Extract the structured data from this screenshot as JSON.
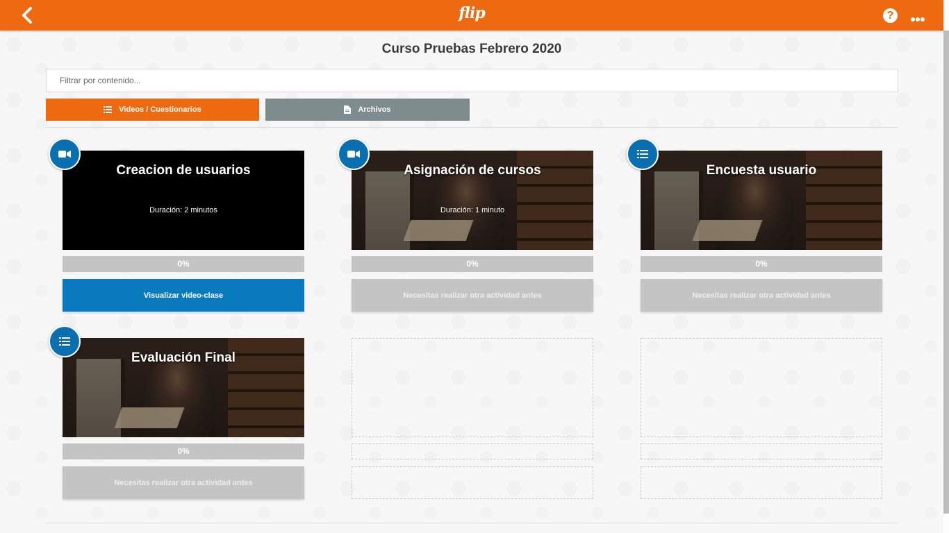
{
  "header": {
    "logo": "flip",
    "help_label": "?",
    "back_icon": "chevron-left-icon",
    "more_icon": "more-horizontal-icon",
    "color": "#ee6a10"
  },
  "page": {
    "title": "Curso Pruebas Febrero 2020",
    "filter_placeholder": "Filtrar por contenido..."
  },
  "tabs": [
    {
      "label": "Videos / Cuestionarios",
      "icon": "list-icon",
      "active": true,
      "color": "#ee6a10"
    },
    {
      "label": "Archivos",
      "icon": "file-icon",
      "active": false,
      "color": "#7f8c8d"
    }
  ],
  "cards": [
    {
      "type": "video",
      "icon": "video-camera-icon",
      "title": "Creacion de usuarios",
      "duration": "Duración: 2 minutos",
      "progress": "0%",
      "action": "Visualizar video-clase",
      "action_enabled": true,
      "thumbnail": "black"
    },
    {
      "type": "video",
      "icon": "video-camera-icon",
      "title": "Asignación de cursos",
      "duration": "Duración: 1 minuto",
      "progress": "0%",
      "action": "Necesitas realizar otra actividad antes",
      "action_enabled": false,
      "thumbnail": "photo"
    },
    {
      "type": "survey",
      "icon": "list-icon",
      "title": "Encuesta usuario",
      "duration": "",
      "progress": "0%",
      "action": "Necesitas realizar otra actividad antes",
      "action_enabled": false,
      "thumbnail": "photo"
    },
    {
      "type": "survey",
      "icon": "list-icon",
      "title": "Evaluación Final",
      "duration": "",
      "progress": "0%",
      "action": "Necesitas realizar otra actividad antes",
      "action_enabled": false,
      "thumbnail": "photo"
    }
  ],
  "colors": {
    "primary_action": "#0a7abf",
    "badge": "#0a6fb0",
    "disabled": "#c4c4c4"
  }
}
